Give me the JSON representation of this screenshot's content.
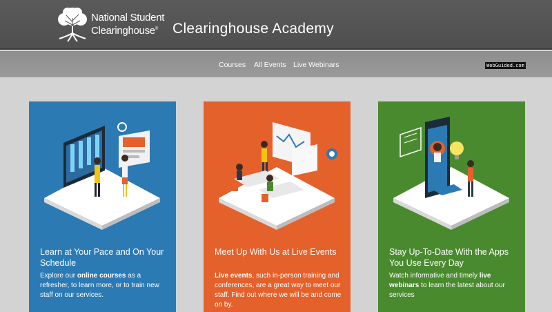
{
  "header": {
    "logo_line1": "National Student",
    "logo_line2": "Clearinghouse",
    "logo_mark": "®",
    "site_title": "Clearinghouse Academy"
  },
  "nav": {
    "items": [
      "Courses",
      "All Events",
      "Live Webinars"
    ]
  },
  "watermark": "WebGuided.com",
  "colors": {
    "header_bg": "#555555",
    "nav_bg": "#949494",
    "page_bg": "#d3d3d3",
    "card_blue": "#2b7ab4",
    "card_orange": "#e4612b",
    "card_green": "#4a8a2f"
  },
  "cards": [
    {
      "title": "Learn at Your Pace and On Your Schedule",
      "body_pre": "Explore our ",
      "body_bold": "online courses",
      "body_post": " as a refresher, to learn more, or to train new staff on our services."
    },
    {
      "title": "Meet Up With Us at Live Events",
      "body_pre": "",
      "body_bold": "Live events",
      "body_post": ", such in-person training and conferences, are a great way to meet our staff. Find out where we will be and come on by."
    },
    {
      "title": "Stay Up-To-Date With the Apps You Use Every Day",
      "body_pre": "Watch informative and timely ",
      "body_bold": "live webinars",
      "body_post": " to learn the latest about our services"
    }
  ]
}
